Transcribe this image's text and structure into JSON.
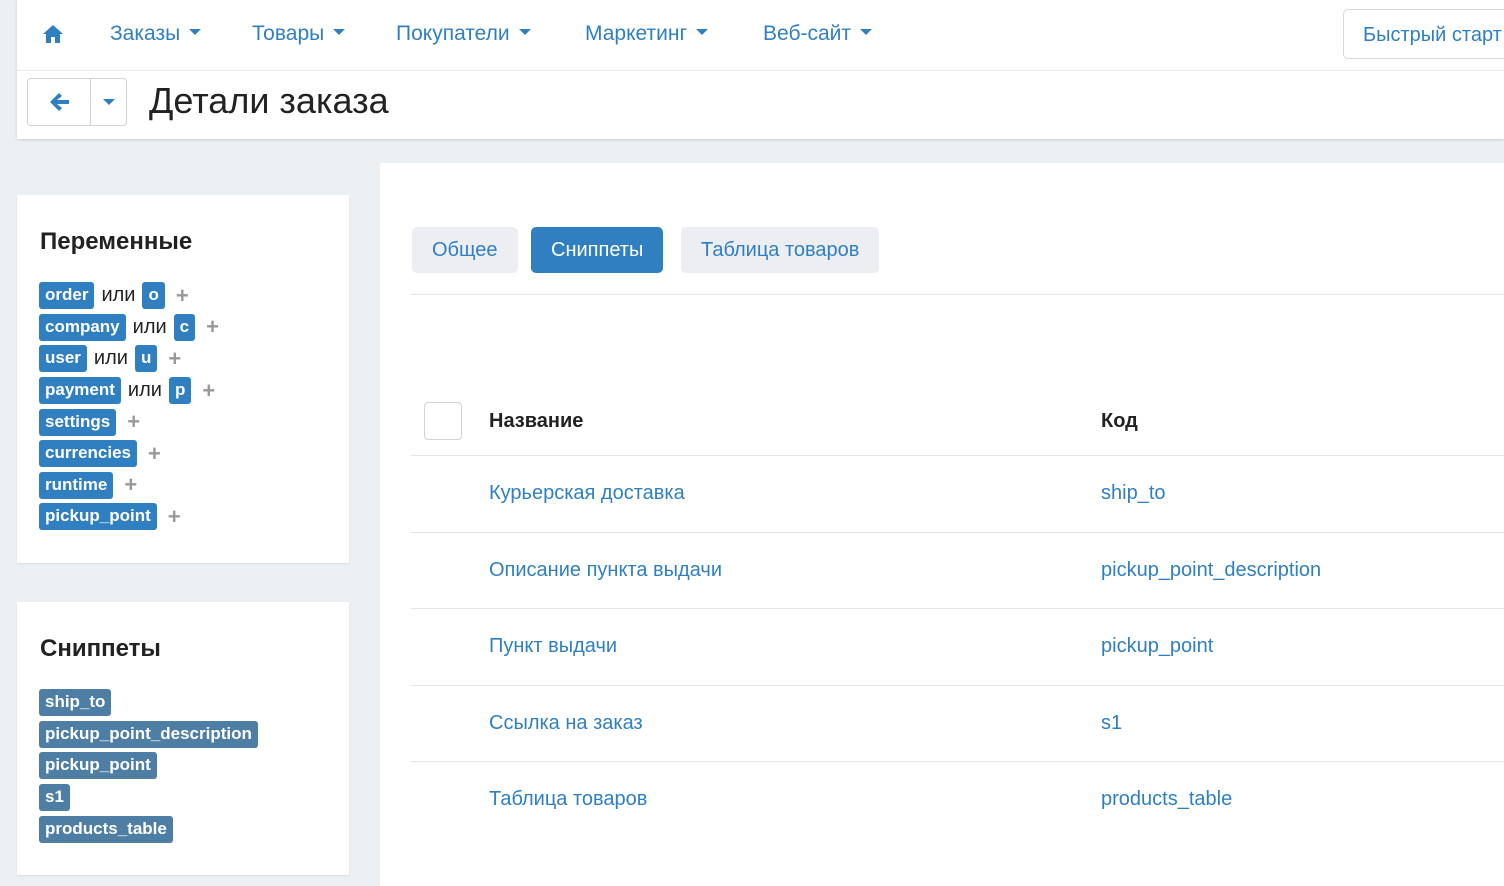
{
  "nav": {
    "items": [
      {
        "label": "Заказы"
      },
      {
        "label": "Товары"
      },
      {
        "label": "Покупатели"
      },
      {
        "label": "Маркетинг"
      },
      {
        "label": "Веб-сайт"
      }
    ],
    "quick_start": "Быстрый старт"
  },
  "header": {
    "title": "Детали заказа"
  },
  "variables_panel": {
    "title": "Переменные",
    "or_word": "или",
    "rows": [
      {
        "name": "order",
        "alias": "o"
      },
      {
        "name": "company",
        "alias": "c"
      },
      {
        "name": "user",
        "alias": "u"
      },
      {
        "name": "payment",
        "alias": "p"
      },
      {
        "name": "settings"
      },
      {
        "name": "currencies"
      },
      {
        "name": "runtime"
      },
      {
        "name": "pickup_point"
      }
    ]
  },
  "snippets_panel": {
    "title": "Сниппеты",
    "items": [
      "ship_to",
      "pickup_point_description",
      "pickup_point",
      "s1",
      "products_table"
    ]
  },
  "tabs": [
    {
      "label": "Общее",
      "active": false
    },
    {
      "label": "Сниппеты",
      "active": true
    },
    {
      "label": "Таблица товаров",
      "active": false
    }
  ],
  "table": {
    "columns": [
      "Название",
      "Код"
    ],
    "rows": [
      {
        "name": "Курьерская доставка",
        "code": "ship_to"
      },
      {
        "name": "Описание пункта выдачи",
        "code": "pickup_point_description"
      },
      {
        "name": "Пункт выдачи",
        "code": "pickup_point"
      },
      {
        "name": "Ссылка на заказ",
        "code": "s1"
      },
      {
        "name": "Таблица товаров",
        "code": "products_table"
      }
    ]
  },
  "colors": {
    "accent": "#2f7fc1",
    "snippet_tag": "#4e7ea3",
    "background": "#edf0f3"
  }
}
